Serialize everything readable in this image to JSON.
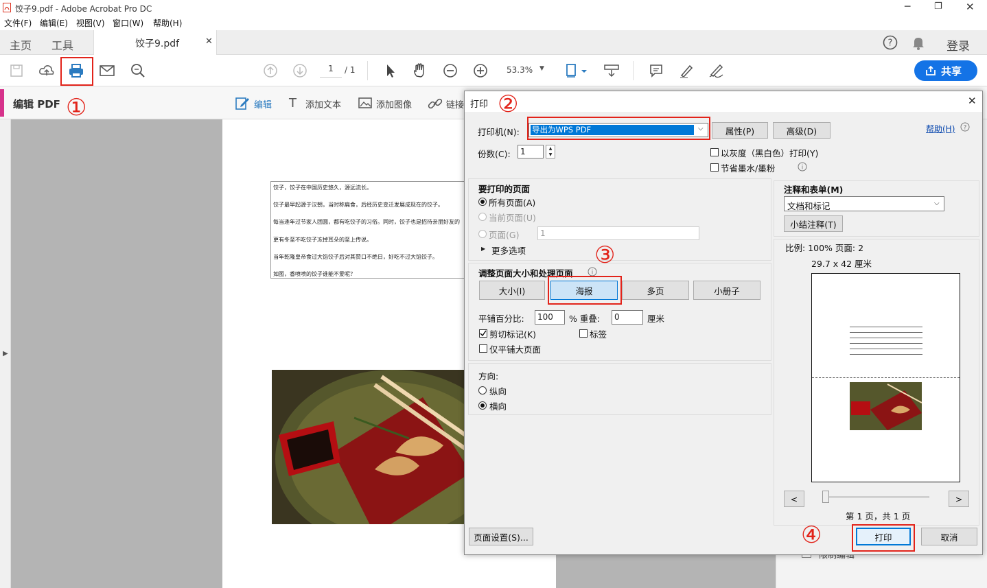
{
  "window": {
    "title": "饺子9.pdf - Adobe Acrobat Pro DC"
  },
  "menu": [
    "文件(F)",
    "编辑(E)",
    "视图(V)",
    "窗口(W)",
    "帮助(H)"
  ],
  "tabs": {
    "home": "主页",
    "tools": "工具",
    "document": "饺子9.pdf",
    "login": "登录"
  },
  "toolbar": {
    "page_current": "1",
    "page_total": "/ 1",
    "zoom": "53.3%",
    "share": "共享"
  },
  "editbar": {
    "title": "编辑 PDF",
    "edit": "编辑",
    "add_text": "添加文本",
    "add_image": "添加图像",
    "link": "链接"
  },
  "document_text": [
    "饺子，饺子在中国历史悠久，源远流长。",
    "饺子最早起源于汉朝，当时称扁食，后经历史变迁发展成现在的饺子。",
    "每当逢年过节家人团圆，都有吃饺子的习俗。同时，饺子也是招待亲朋好友的",
    "更有冬至不吃饺子冻掉耳朵的至上传说。",
    "当年乾隆皇帝食过大馅饺子后对其赞口不绝日，好吃不过大馅饺子。",
    "如图，香喷喷的饺子谁能不爱呢？"
  ],
  "annotations": {
    "n1": "①",
    "n2": "②",
    "n3": "③",
    "n4": "④"
  },
  "dialog": {
    "title": "打印",
    "printer_label": "打印机(N):",
    "printer_value": "导出为WPS PDF",
    "properties": "属性(P)",
    "advanced": "高级(D)",
    "help": "帮助(H)",
    "copies_label": "份数(C):",
    "copies_value": "1",
    "grayscale": "以灰度（黑白色）打印(Y)",
    "save_ink": "节省墨水/墨粉",
    "pages_group": "要打印的页面",
    "all_pages": "所有页面(A)",
    "current_page": "当前页面(U)",
    "pages": "页面(G)",
    "pages_value": "1",
    "more_options": "更多选项",
    "sizing_group": "调整页面大小和处理页面",
    "size_btn": "大小(I)",
    "poster_btn": "海报",
    "multi_btn": "多页",
    "booklet_btn": "小册子",
    "tile_scale_label": "平铺百分比:",
    "tile_scale_value": "100",
    "overlap_label": "% 重叠:",
    "overlap_value": "0",
    "overlap_unit": "厘米",
    "cut_marks": "剪切标记(K)",
    "labels": "标签",
    "tile_large_only": "仅平铺大页面",
    "orientation_label": "方向:",
    "portrait": "纵向",
    "landscape": "横向",
    "comments_group": "注释和表单(M)",
    "comments_value": "文档和标记",
    "summarize": "小结注释(T)",
    "scale_text": "比例: 100% 页面: 2",
    "paper_size": "29.7 x 42 厘米",
    "page_info": "第 1 页，共 1 页",
    "page_setup": "页面设置(S)...",
    "print": "打印",
    "cancel": "取消",
    "prev": "<",
    "next": ">"
  },
  "hidden_text": "限制编辑"
}
